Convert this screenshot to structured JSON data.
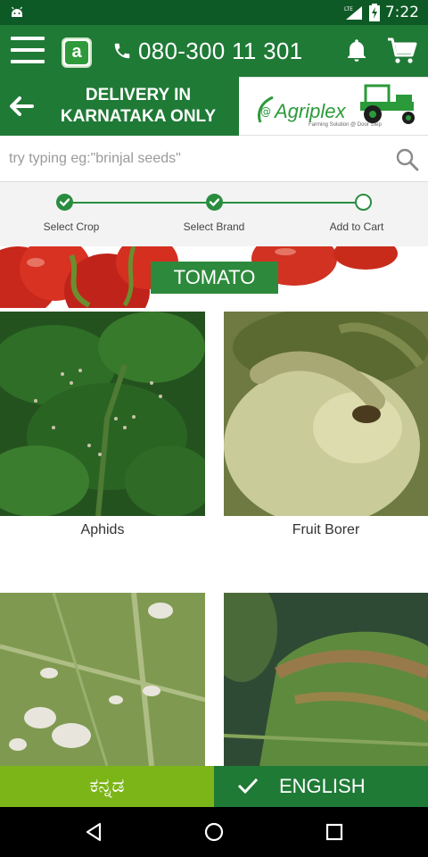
{
  "status_bar": {
    "time": "7:22",
    "network": "LTE"
  },
  "header": {
    "phone_number": "080-300 11 301",
    "logo_letter": "a"
  },
  "banner": {
    "line1": "DELIVERY IN",
    "line2": "KARNATAKA ONLY",
    "brand": "Agriplex",
    "brand_tagline": "Farming Solution @ Door Step"
  },
  "search": {
    "placeholder": "try typing eg:\"brinjal seeds\""
  },
  "stepper": {
    "steps": [
      {
        "label": "Select Crop",
        "state": "done"
      },
      {
        "label": "Select Brand",
        "state": "done"
      },
      {
        "label": "Add to Cart",
        "state": "pending"
      }
    ]
  },
  "crop": {
    "title": "TOMATO"
  },
  "pests": [
    {
      "name": "Aphids"
    },
    {
      "name": "Fruit Borer"
    },
    {
      "name": ""
    },
    {
      "name": ""
    }
  ],
  "language": {
    "kannada": "ಕನ್ನಡ",
    "english": "ENGLISH",
    "selected": "english"
  },
  "colors": {
    "primary_dark": "#0e5a26",
    "primary": "#1f7a36",
    "accent_lime": "#7cb518"
  }
}
